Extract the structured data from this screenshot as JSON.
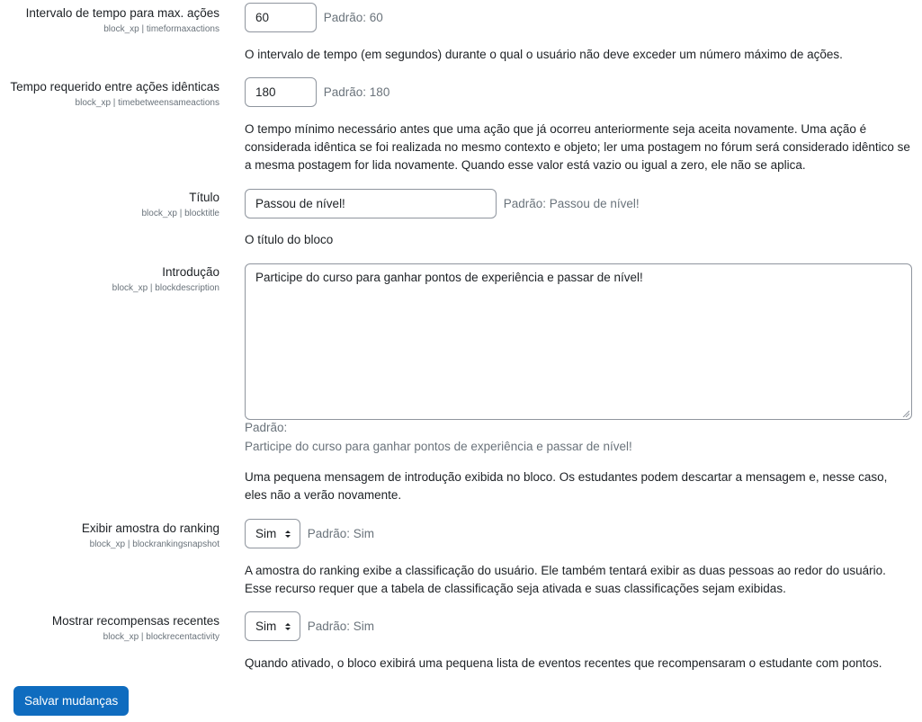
{
  "settings": [
    {
      "label": "Intervalo de tempo para max. ações",
      "key": "block_xp | timeformaxactions",
      "value": "60",
      "default": "Padrão: 60",
      "description": "O intervalo de tempo (em segundos) durante o qual o usuário não deve exceder um número máximo de ações."
    },
    {
      "label": "Tempo requerido entre ações idênticas",
      "key": "block_xp | timebetweensameactions",
      "value": "180",
      "default": "Padrão: 180",
      "description": "O tempo mínimo necessário antes que uma ação que já ocorreu anteriormente seja aceita novamente. Uma ação é considerada idêntica se foi realizada no mesmo contexto e objeto; ler uma postagem no fórum será considerado idêntico se a mesma postagem for lida novamente. Quando esse valor está vazio ou igual a zero, ele não se aplica."
    },
    {
      "label": "Título",
      "key": "block_xp | blocktitle",
      "value": "Passou de nível!",
      "default": "Padrão: Passou de nível!",
      "description": "O título do bloco"
    },
    {
      "label": "Introdução",
      "key": "block_xp | blockdescription",
      "value": "Participe do curso para ganhar pontos de experiência e passar de nível!",
      "default_label": "Padrão:",
      "default_value": "Participe do curso para ganhar pontos de experiência e passar de nível!",
      "description": "Uma pequena mensagem de introdução exibida no bloco. Os estudantes podem descartar a mensagem e, nesse caso, eles não a verão novamente."
    },
    {
      "label": "Exibir amostra do ranking",
      "key": "block_xp | blockrankingsnapshot",
      "value": "Sim",
      "default": "Padrão: Sim",
      "description": "A amostra do ranking exibe a classificação do usuário. Ele também tentará exibir as duas pessoas ao redor do usuário. Esse recurso requer que a tabela de classificação seja ativada e suas classificações sejam exibidas."
    },
    {
      "label": "Mostrar recompensas recentes",
      "key": "block_xp | blockrecentactivity",
      "value": "Sim",
      "default": "Padrão: Sim",
      "description": "Quando ativado, o bloco exibirá uma pequena lista de eventos recentes que recompensaram o estudante com pontos."
    }
  ],
  "save_button": "Salvar mudanças",
  "colors": {
    "primary": "#0f6cbf",
    "muted": "#6a737b",
    "border": "#8f959e"
  }
}
